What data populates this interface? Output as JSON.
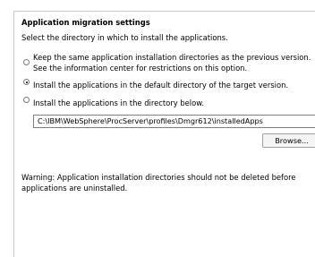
{
  "section": {
    "title": "Application migration settings",
    "intro": "Select the directory in which to install the applications."
  },
  "options": [
    {
      "line1": "Keep the same application installation directories as the previous version.",
      "line2": "See the information center for restrictions on this option.",
      "selected": false
    },
    {
      "label": "Install the applications in the default directory of the target version.",
      "selected": true
    },
    {
      "label": "Install the applications in the directory below.",
      "selected": false
    }
  ],
  "directory": {
    "value": "C:\\IBM\\WebSphere\\ProcServer\\profiles\\Dmgr612\\installedApps"
  },
  "browse": {
    "label": "Browse..."
  },
  "warning": {
    "line1": "Warning: Application installation directories should not be deleted before",
    "line2": "applications are uninstalled."
  }
}
